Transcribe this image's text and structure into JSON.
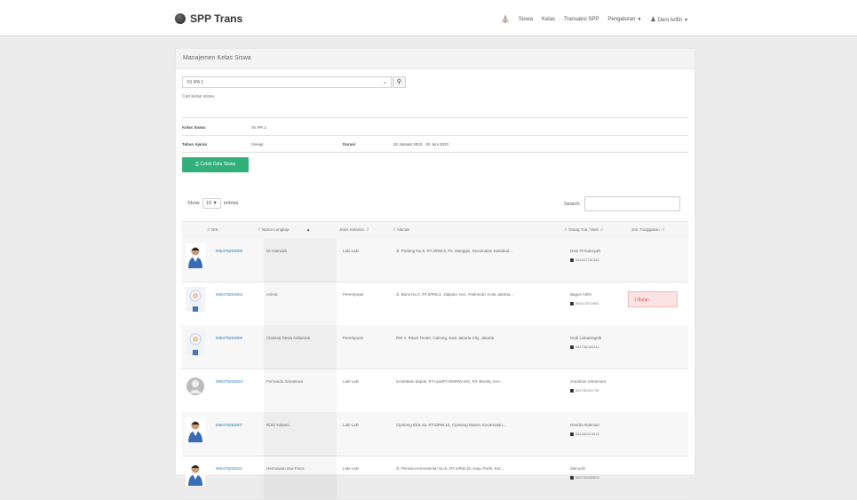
{
  "navbar": {
    "brand": "SPP Trans",
    "items": [
      {
        "label": "Siswa"
      },
      {
        "label": "Kelas"
      },
      {
        "label": "Transaksi SPP"
      },
      {
        "label": "Pengaturan"
      },
      {
        "label": "Deni Arifin"
      }
    ]
  },
  "panel": {
    "title": "Manajemen Kelas Siswa",
    "select_value": "XII IPA 1",
    "hint": "Cari kelas siswa",
    "info": {
      "kelas_label": "Kelas Siswa",
      "kelas_value": "XII IPA 1",
      "tahun_label": "Tahun Ajaran",
      "tahun_value": "Genap",
      "durasi_label": "Durasi",
      "durasi_value": "02 Januari 2023 - 30 Juni 2023"
    },
    "print_button": "Cetak Data Siswa"
  },
  "table": {
    "show_label": "Show",
    "length_value": "10",
    "entries_label": "entries",
    "search_label": "Search:",
    "headers": [
      "NIS",
      "Nama Lengkap",
      "Jenis Kelamin",
      "Alamat",
      "Orang Tua / Wali",
      "Jml. Tunggakan"
    ],
    "rows": [
      {
        "nis": "006475253000",
        "nama": "M. Hamzah",
        "jk": "Laki-Laki",
        "alamat": "Jl. Padang No.8, RT.3/RW.8, Ps. Manggis, Kecamatan Setiabud...",
        "wali": "Dani Firmansyah",
        "phone": "081622781383",
        "tunggakan": ""
      },
      {
        "nis": "006475253003",
        "nama": "Azima",
        "jk": "Perempuan",
        "alamat": "Jl. Bumi No.2, RT.8/RW.2, Jatipulo, Kec. Palmerah, Kota Jakarta...",
        "wali": "Bagus Arifin",
        "phone": "082113272631",
        "tunggakan": "1 Bulan"
      },
      {
        "nis": "006475253005",
        "nama": "Clarissa Devia Anbarsari",
        "jk": "Perempuan",
        "alamat": "RW 4, Rawa Terate, Cakung, East Jakarta City, Jakarta",
        "wali": "Dedi Listianingsih",
        "phone": "081736283244",
        "tunggakan": ""
      },
      {
        "nis": "006475253023",
        "nama": "Fernando Simamora",
        "jk": "Laki-Laki",
        "alamat": "Kontrakan bapak, RT.nya/RT.005/RW.022, Pd. Benda, Kec...",
        "wali": "Jonathan Simamora",
        "phone": "081782611733",
        "tunggakan": ""
      },
      {
        "nis": "006475253007",
        "nama": "Rizki Yulanto",
        "jk": "Laki-Laki",
        "alamat": "Cipinang Elok 3a, RT.5/RW.10, Cipinang Muara, Kecamatan...",
        "wali": "Hendra Rahman",
        "phone": "081382613918",
        "tunggakan": ""
      },
      {
        "nis": "006475253011",
        "nama": "Hermawan Dwi Putra",
        "jk": "Laki-Laki",
        "alamat": "Jl. Pemda Kementerian No.5, RT.1/RW.15, Kayu Putih, Kec...",
        "wali": "Zainudin",
        "phone": "081726282823",
        "tunggakan": ""
      }
    ]
  },
  "colors": {
    "primary_button": "#31b07a",
    "link": "#2a7ab8",
    "badge_bg": "#fbe3e3",
    "badge_text": "#d9534f"
  }
}
